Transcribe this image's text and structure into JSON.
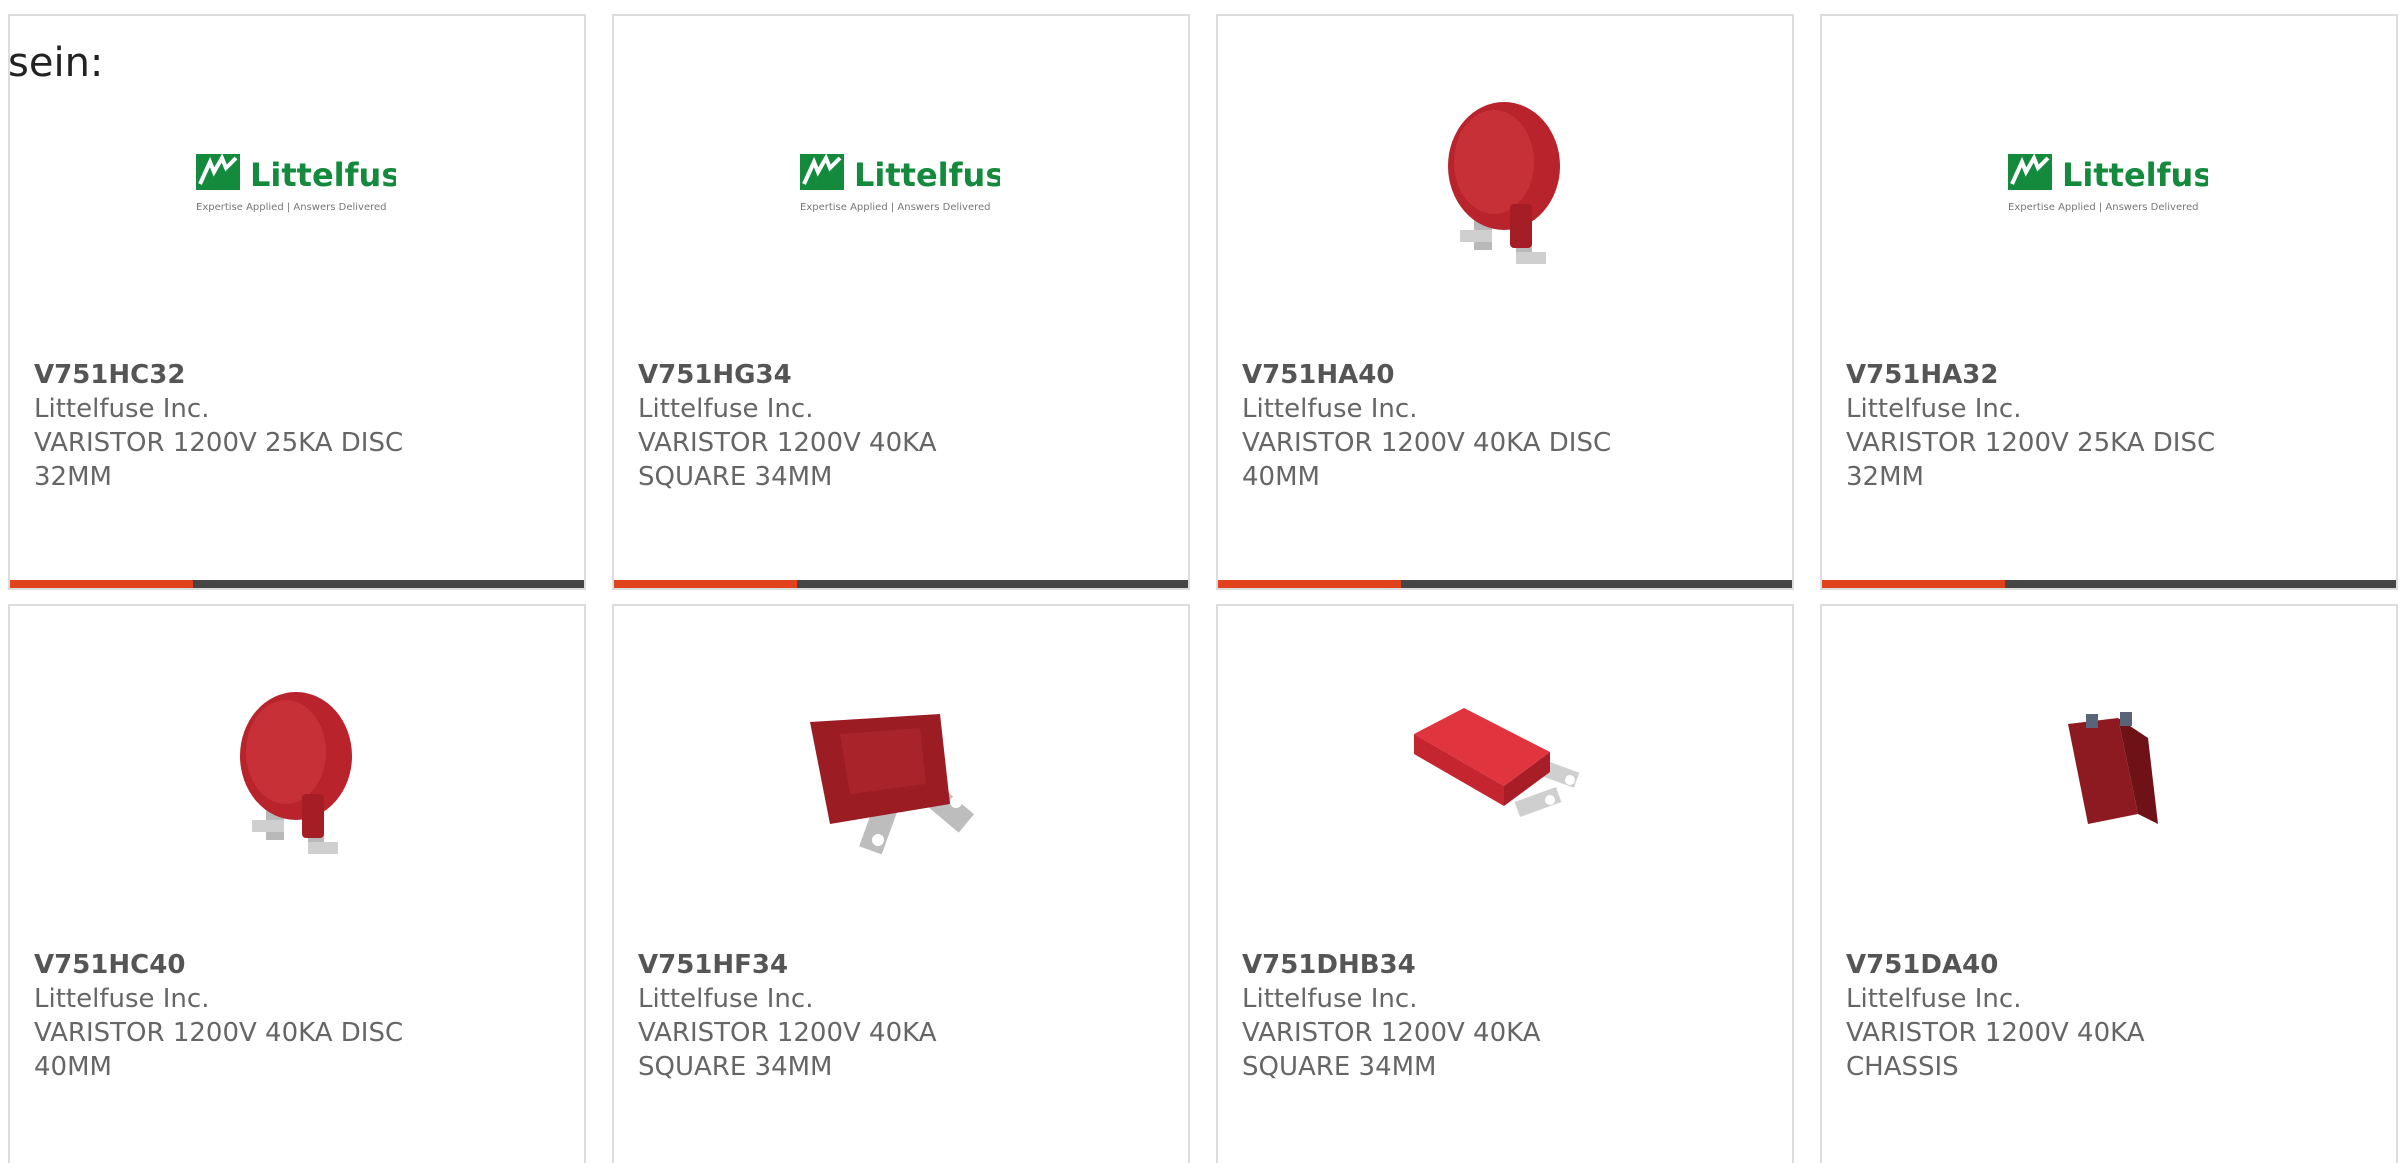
{
  "intro_text": "sein:",
  "colors": {
    "accent": "#e0421b",
    "bar_dark": "#464646",
    "logo_green": "#138a3c",
    "varistor_red": "#b8232c"
  },
  "logo": {
    "name": "Littelfuse",
    "tagline": "Expertise Applied | Answers Delivered"
  },
  "products": [
    {
      "part_number": "V751HC32",
      "manufacturer": "Littelfuse Inc.",
      "description": "VARISTOR 1200V 25KA DISC 32MM",
      "image": "littelfuse-logo"
    },
    {
      "part_number": "V751HG34",
      "manufacturer": "Littelfuse Inc.",
      "description": "VARISTOR 1200V 40KA SQUARE 34MM",
      "image": "littelfuse-logo"
    },
    {
      "part_number": "V751HA40",
      "manufacturer": "Littelfuse Inc.",
      "description": "VARISTOR 1200V 40KA DISC 40MM",
      "image": "disc-varistor"
    },
    {
      "part_number": "V751HA32",
      "manufacturer": "Littelfuse Inc.",
      "description": "VARISTOR 1200V 25KA DISC 32MM",
      "image": "littelfuse-logo"
    },
    {
      "part_number": "V751HC40",
      "manufacturer": "Littelfuse Inc.",
      "description": "VARISTOR 1200V 40KA DISC 40MM",
      "image": "disc-varistor"
    },
    {
      "part_number": "V751HF34",
      "manufacturer": "Littelfuse Inc.",
      "description": "VARISTOR 1200V 40KA SQUARE 34MM",
      "image": "square-varistor-dark"
    },
    {
      "part_number": "V751DHB34",
      "manufacturer": "Littelfuse Inc.",
      "description": "VARISTOR 1200V 40KA SQUARE 34MM",
      "image": "square-varistor-bright"
    },
    {
      "part_number": "V751DA40",
      "manufacturer": "Littelfuse Inc.",
      "description": "VARISTOR 1200V 40KA CHASSIS",
      "image": "chassis-varistor"
    }
  ]
}
